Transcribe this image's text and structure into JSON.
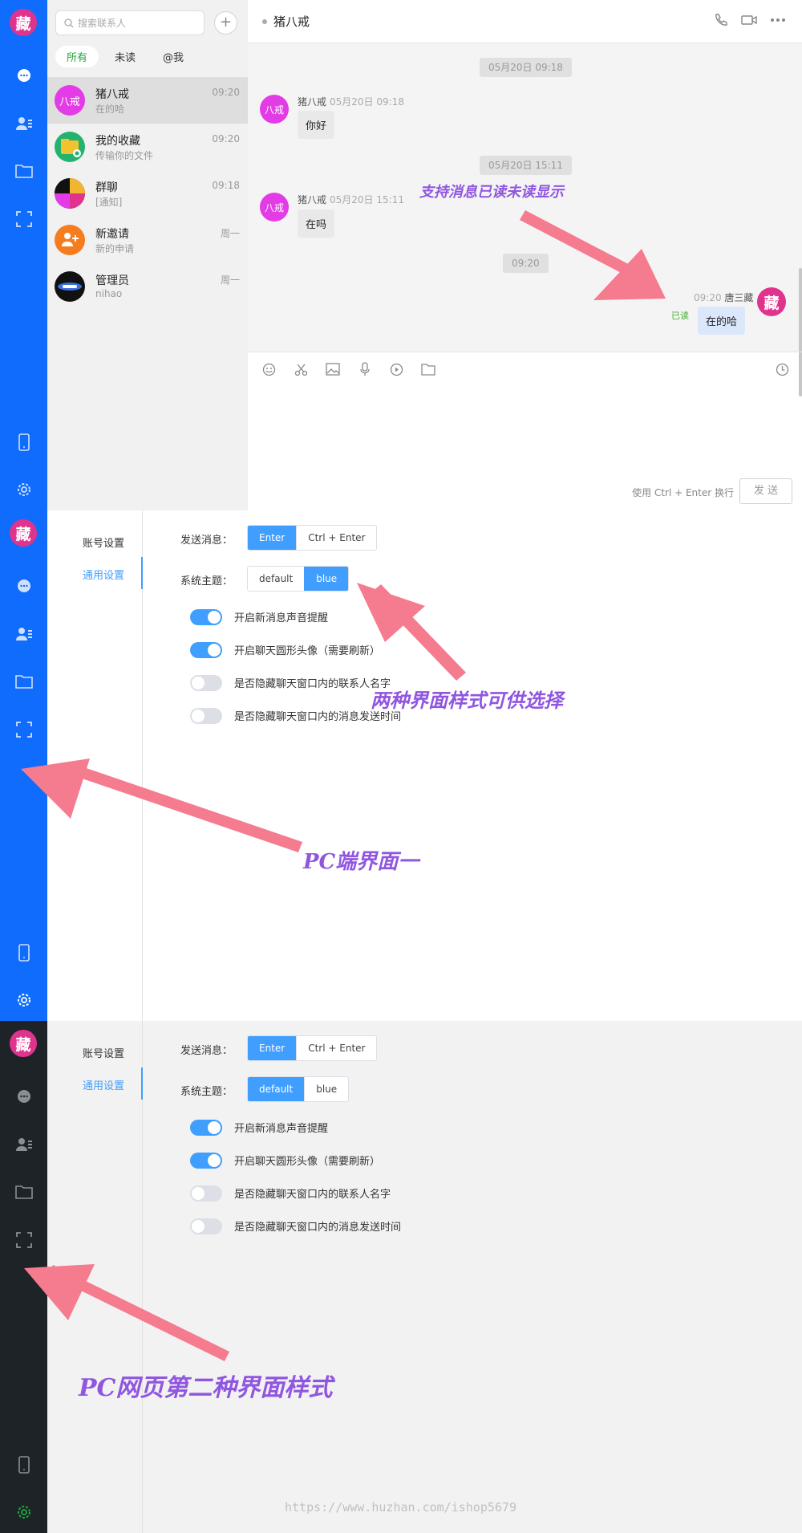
{
  "app": {
    "logo_char": "藏",
    "accent": "#0f6cfd",
    "dark_rail": "#1e2328",
    "active_green": "#1ea83b"
  },
  "contacts": {
    "search_placeholder": "搜索联系人",
    "add_label": "+",
    "filters": [
      "所有",
      "未读",
      "@我"
    ],
    "items": [
      {
        "name": "猪八戒",
        "sub": "在的哈",
        "time": "09:20",
        "avatar_text": "八戒",
        "avatar_color": "#e33ce6",
        "selected": true
      },
      {
        "name": "我的收藏",
        "sub": "传输你的文件",
        "time": "09:20",
        "avatar_text": "",
        "avatar_color": "#1ea83b",
        "selected": false
      },
      {
        "name": "群聊",
        "sub": "[通知]",
        "time": "09:18",
        "avatar_text": "",
        "avatar_color": "#222222",
        "selected": false
      },
      {
        "name": "新邀请",
        "sub": "新的申请",
        "time": "周一",
        "avatar_text": "",
        "avatar_color": "#f57c1f",
        "selected": false
      },
      {
        "name": "管理员",
        "sub": "nihao",
        "time": "周一",
        "avatar_text": "",
        "avatar_color": "#111111",
        "selected": false
      }
    ]
  },
  "chat": {
    "title": "猪八戒",
    "stamps": [
      "05月20日 09:18",
      "05月20日 15:11",
      "09:20"
    ],
    "messages": [
      {
        "sender": "猪八戒",
        "time": "05月20日 09:18",
        "text": "你好",
        "avatar": "八戒"
      },
      {
        "sender": "猪八戒",
        "time": "05月20日 15:11",
        "text": "在吗",
        "avatar": "八戒"
      },
      {
        "sender": "唐三藏",
        "time": "09:20",
        "text": "在的哈",
        "avatar": "藏",
        "read": "已读"
      }
    ],
    "input_hint": "使用 Ctrl + Enter 换行",
    "send_label": "发 送"
  },
  "settings": {
    "menu": [
      "账号设置",
      "通用设置"
    ],
    "send_label": "发送消息：",
    "send_options": [
      "Enter",
      "Ctrl + Enter"
    ],
    "theme_label": "系统主题：",
    "theme_options": [
      "default",
      "blue"
    ],
    "toggles": [
      {
        "label": "开启新消息声音提醒",
        "on": true
      },
      {
        "label": "开启聊天圆形头像（需要刷新）",
        "on": true
      },
      {
        "label": "是否隐藏聊天窗口内的联系人名字",
        "on": false
      },
      {
        "label": "是否隐藏聊天窗口内的消息发送时间",
        "on": false
      }
    ]
  },
  "annotations": {
    "read_status": "支持消息已读未读显示",
    "themes": "两种界面样式可供选择",
    "pc_one": "PC端界面一",
    "pc_two": "PC网页第二种界面样式",
    "watermark": "https://www.huzhan.com/ishop5679"
  }
}
